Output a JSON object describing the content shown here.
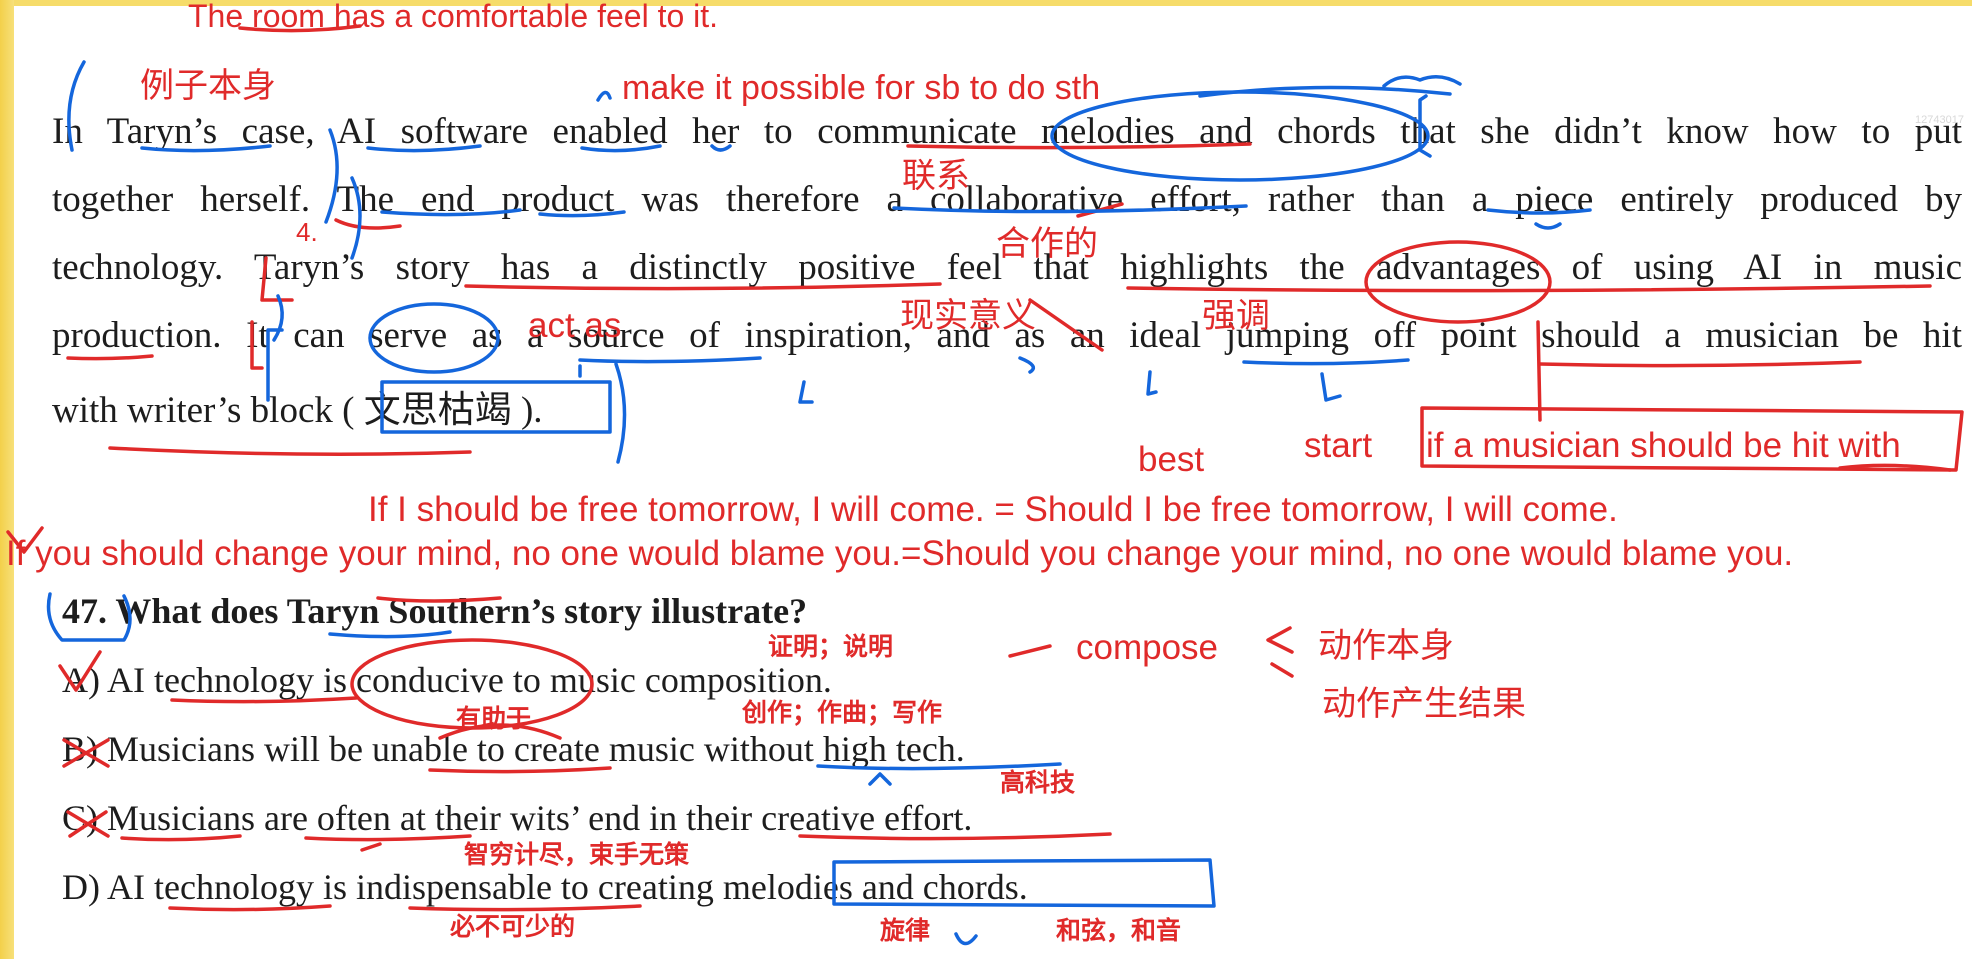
{
  "passage": {
    "lines": [
      "In Taryn’s case, AI software enabled her to communicate melodies and chords that she didn’t know how to put",
      "together herself. The end product was therefore a collaborative effort, rather than a piece entirely produced by",
      "technology. Taryn’s story has a distinctly positive feel that highlights the advantages of using AI in music",
      "production. It can serve as a source of inspiration, and as an ideal jumping off point should a musician be hit",
      "with writer’s block ( 文思枯竭 )."
    ]
  },
  "question": {
    "number": "47.",
    "stem": "What does Taryn Southern’s story illustrate?",
    "options": [
      "A) AI technology is conducive to music composition.",
      "B) Musicians will be unable to create music without high tech.",
      "C) Musicians are often at their wits’ end in their creative effort.",
      "D) AI technology is indispensable to creating melodies and chords."
    ]
  },
  "annotations": {
    "top_sentence": "The room has a comfortable feel to it.",
    "example_itself": "例子本身",
    "make_possible": "make it possible for sb to do sth",
    "connect": "联系",
    "cooperative": "合作的",
    "practical_meaning": "现实意义",
    "emphasize": "强调",
    "act_as": "act as",
    "number_4": "4.",
    "best": "best",
    "start": "start",
    "if_musician": "if a musician should be hit with",
    "example_1": "If I should be free tomorrow, I will come. = Should I be free tomorrow, I will come.",
    "example_2": "If you should change your mind, no one would blame you.=Should you change your mind, no one would blame you.",
    "prove_explain": "证明；说明",
    "compose": "compose",
    "action_itself": "动作本身",
    "action_result": "动作产生结果",
    "beneficial": "有助于",
    "create_compose_write": "创作；作曲；写作",
    "high_tech": "高科技",
    "wits_end": "智穷计尽，束手无策",
    "indispensable": "必不可少的",
    "melody": "旋律",
    "chords": "和弦，和音"
  },
  "colors": {
    "text": "#1d1d1d",
    "red_ink": "#e02a2a",
    "blue_ink": "#1466dc",
    "frame": "#f3d04a"
  }
}
